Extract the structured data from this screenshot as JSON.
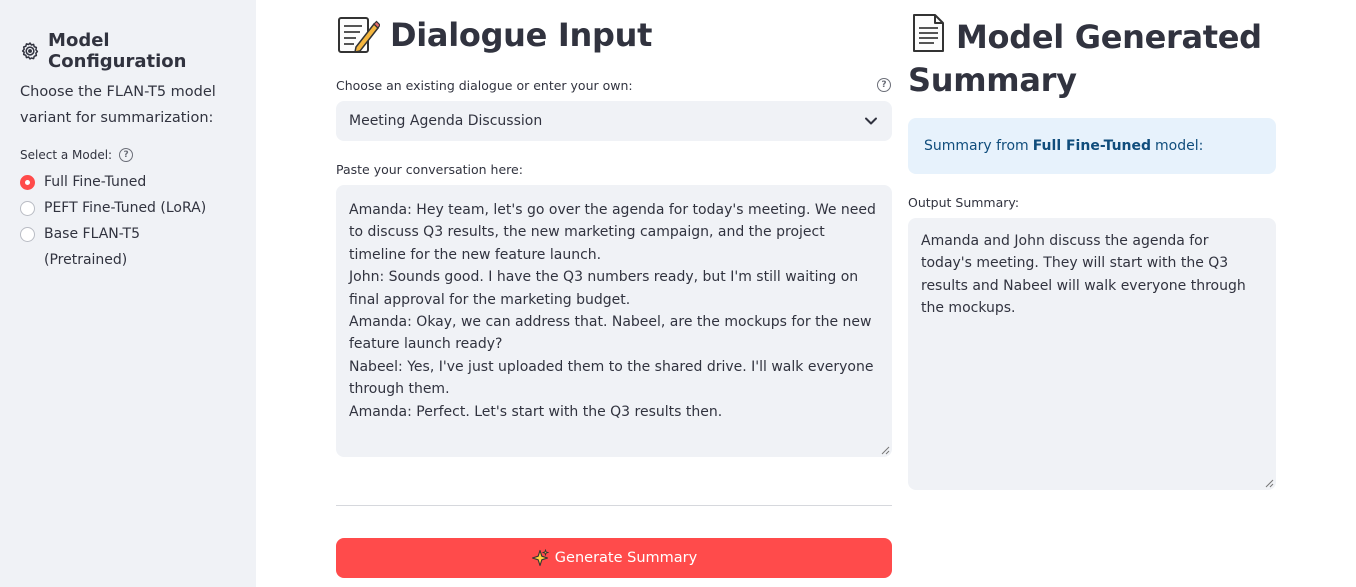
{
  "sidebar": {
    "title": "Model Configuration",
    "description": "Choose the FLAN-T5 model variant for summarization:",
    "select_label": "Select a Model:",
    "options": [
      {
        "label": "Full Fine-Tuned",
        "selected": true
      },
      {
        "label": "PEFT Fine-Tuned (LoRA)",
        "selected": false
      },
      {
        "label": "Base FLAN-T5 (Pretrained)",
        "selected": false
      }
    ]
  },
  "input": {
    "heading": "Dialogue Input",
    "choose_label": "Choose an existing dialogue or enter your own:",
    "selected_dialogue": "Meeting Agenda Discussion",
    "paste_label": "Paste your conversation here:",
    "conversation": [
      "Amanda: Hey team, let's go over the agenda for today's meeting. We need to discuss Q3 results, the new marketing campaign, and the project timeline for the new feature launch.",
      "John: Sounds good. I have the Q3 numbers ready, but I'm still waiting on final approval for the marketing budget.",
      "Amanda: Okay, we can address that. Nabeel, are the mockups for the new feature launch ready?",
      "Nabeel: Yes, I've just uploaded them to the shared drive. I'll walk everyone through them.",
      "Amanda: Perfect. Let's start with the Q3 results then."
    ],
    "button_label": "Generate Summary"
  },
  "output": {
    "heading": "Model Generated Summary",
    "info_prefix": "Summary from ",
    "info_model": "Full Fine-Tuned",
    "info_suffix": " model:",
    "output_label": "Output Summary:",
    "summary": "Amanda and John discuss the agenda for today's meeting. They will start with the Q3 results and Nabeel will walk everyone through the mockups."
  },
  "colors": {
    "primary": "#ff4b4b",
    "sidebar_bg": "#f0f2f6",
    "info_bg": "#e7f2fc",
    "info_text": "#104d7c"
  },
  "icons": {
    "sidebar_title": "gear-icon",
    "input_heading": "memo-icon",
    "output_heading": "page-icon",
    "button": "sparkles-icon"
  }
}
